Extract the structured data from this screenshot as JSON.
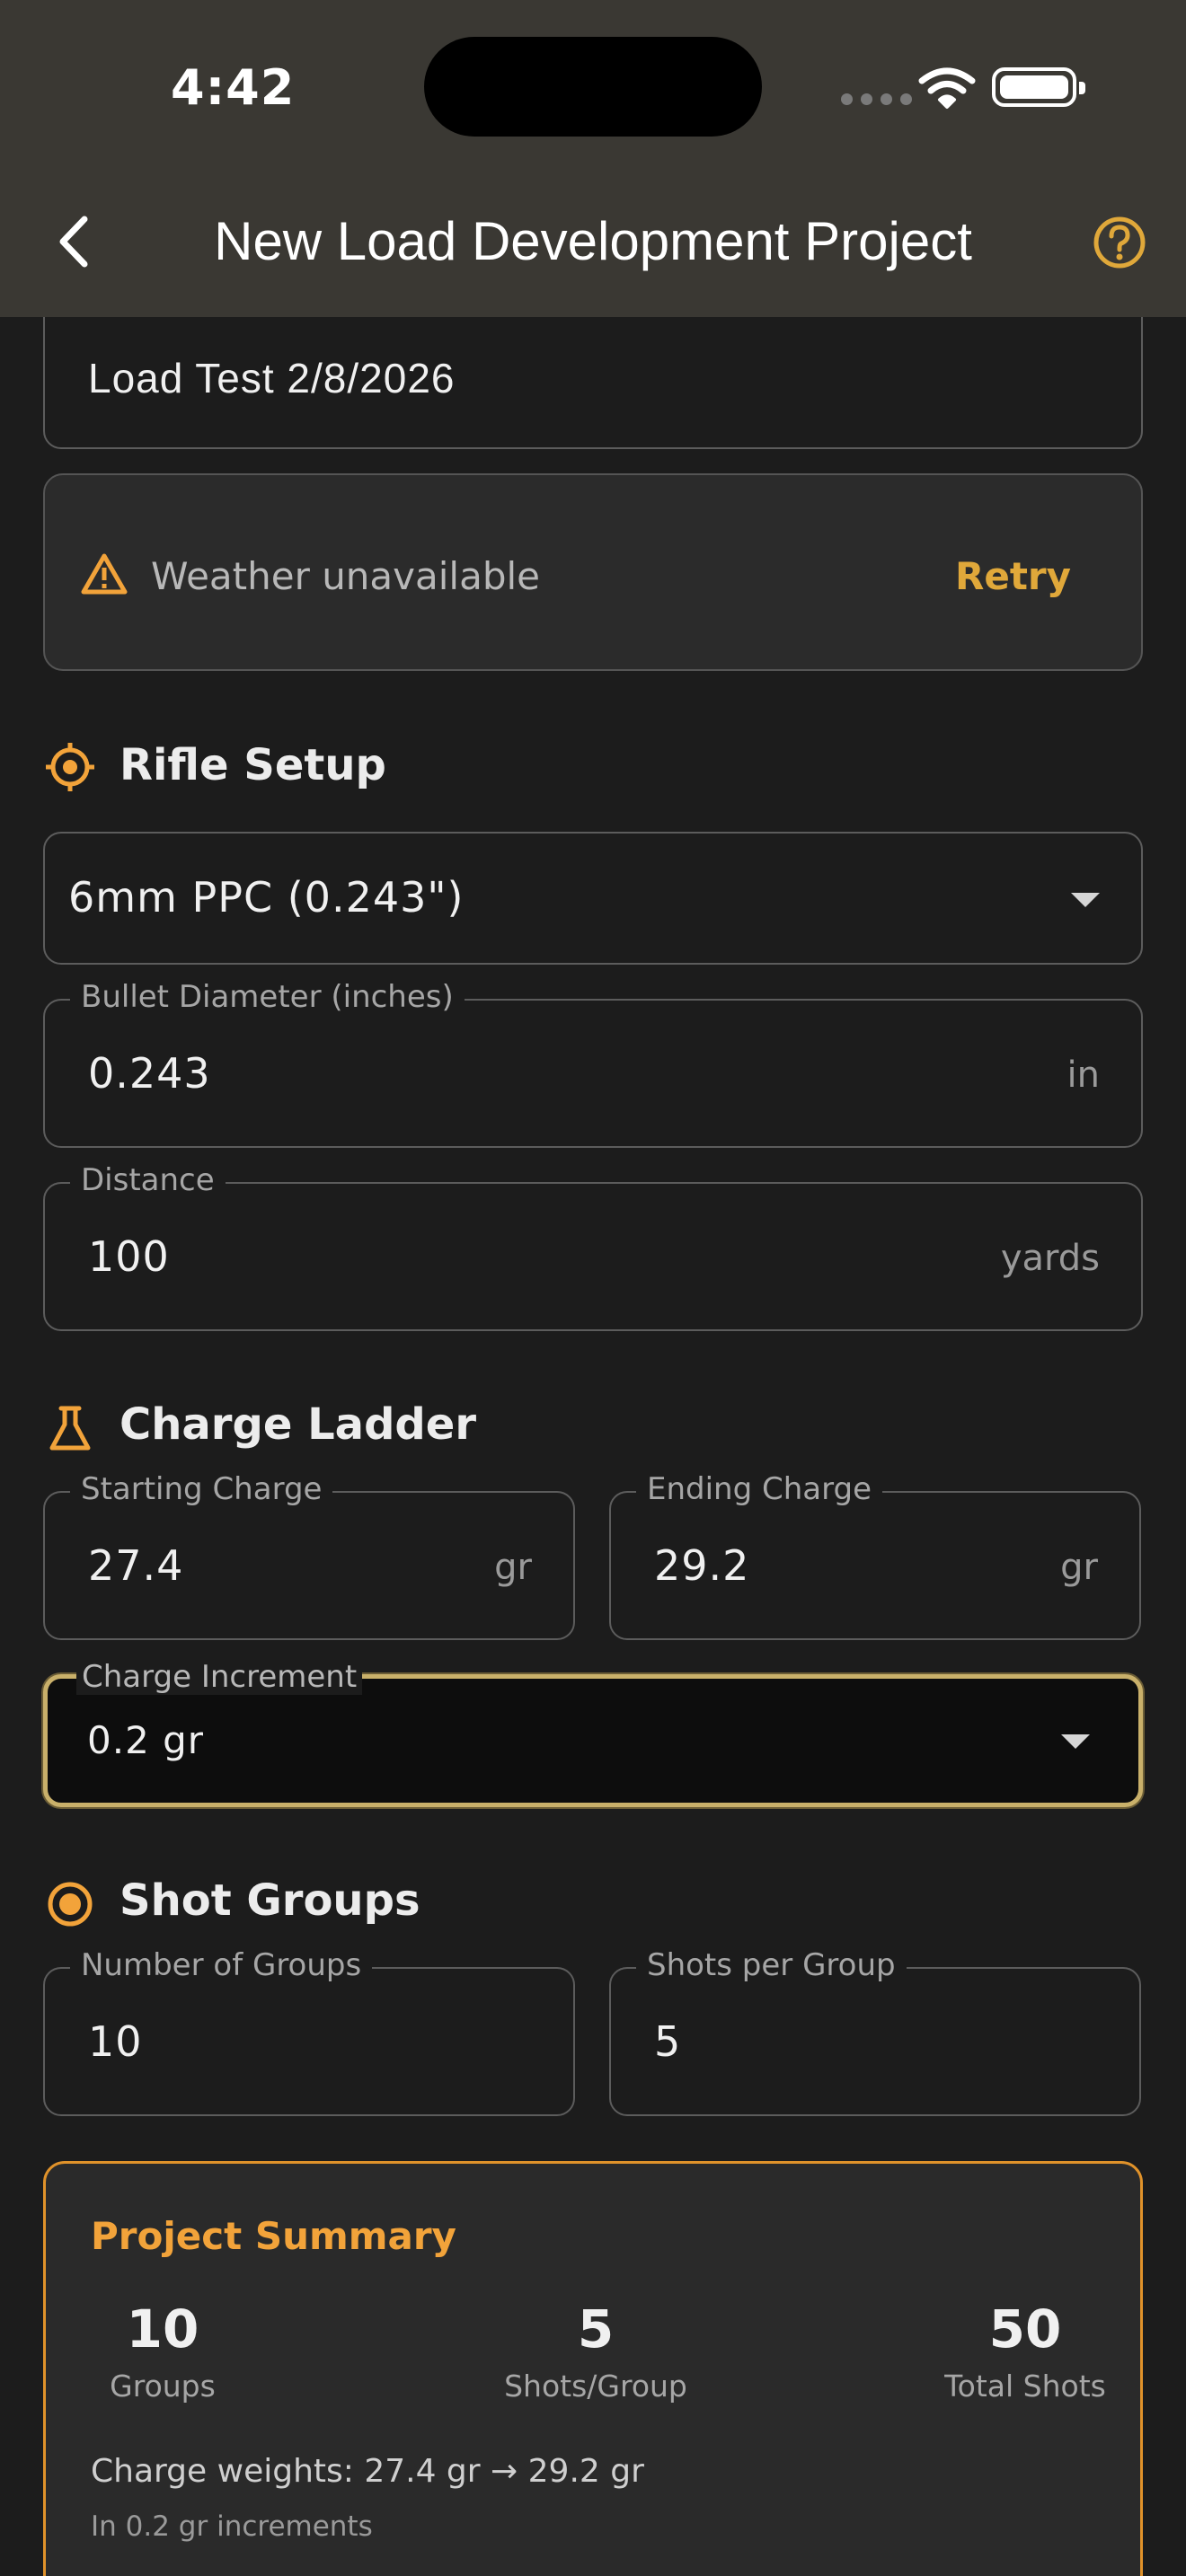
{
  "status_bar": {
    "time": "4:42"
  },
  "nav": {
    "title": "New Load Development Project"
  },
  "project_name": {
    "value": "Load Test 2/8/2026"
  },
  "weather": {
    "message": "Weather unavailable",
    "retry_label": "Retry"
  },
  "rifle_setup": {
    "title": "Rifle Setup",
    "cartridge": {
      "selected": "6mm PPC (0.243\")"
    },
    "bullet_diameter": {
      "label": "Bullet Diameter (inches)",
      "value": "0.243",
      "unit": "in"
    },
    "distance": {
      "label": "Distance",
      "value": "100",
      "unit": "yards"
    }
  },
  "charge_ladder": {
    "title": "Charge Ladder",
    "starting": {
      "label": "Starting Charge",
      "value": "27.4",
      "unit": "gr"
    },
    "ending": {
      "label": "Ending Charge",
      "value": "29.2",
      "unit": "gr"
    },
    "increment": {
      "label": "Charge Increment",
      "selected": "0.2 gr"
    }
  },
  "shot_groups": {
    "title": "Shot Groups",
    "groups": {
      "label": "Number of Groups",
      "value": "10"
    },
    "shots": {
      "label": "Shots per Group",
      "value": "5"
    }
  },
  "summary": {
    "title": "Project Summary",
    "stats": [
      {
        "value": "10",
        "label": "Groups"
      },
      {
        "value": "5",
        "label": "Shots/Group"
      },
      {
        "value": "50",
        "label": "Total Shots"
      }
    ],
    "charge_line": "Charge weights: 27.4 gr → 29.2 gr",
    "increment_line": "In 0.2 gr increments"
  },
  "colors": {
    "accent": "#f2a33a",
    "header_bg": "#3a3833",
    "page_bg": "#1c1c1c",
    "focus_border": "#c9b06a"
  },
  "icons": [
    "back-chevron-icon",
    "help-circle-icon",
    "warning-icon",
    "crosshair-icon",
    "flask-icon",
    "target-icon",
    "dropdown-caret-icon"
  ]
}
